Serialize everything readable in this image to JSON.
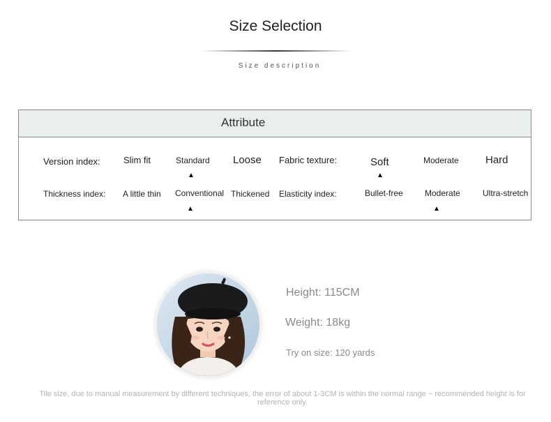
{
  "header": {
    "title": "Size Selection",
    "subtitle": "Size description"
  },
  "table": {
    "header": "Attribute",
    "rows": [
      {
        "label_a": "Version index:",
        "options_a": [
          "Slim fit",
          "Standard",
          "Loose"
        ],
        "selected_a": "Standard",
        "label_b": "Fabric texture:",
        "options_b": [
          "Soft",
          "Moderate",
          "Hard"
        ],
        "selected_b": "Soft"
      },
      {
        "label_a": "Thickness index:",
        "options_a": [
          "A little thin",
          "Conventional",
          "Thickened"
        ],
        "selected_a": "Conventional",
        "label_b": "Elasticity index:",
        "options_b": [
          "Bullet-free",
          "Moderate",
          "Ultra-stretch"
        ],
        "selected_b": "Moderate"
      }
    ],
    "marker": "▲"
  },
  "model": {
    "height": "Height: 115CM",
    "weight": "Weight: 18kg",
    "try_on": "Try on size: 120 yards"
  },
  "note": "Tile size, due to manual measurement by different techniques, the error of about 1-3CM is within the normal range ~ recommended height is for reference only."
}
